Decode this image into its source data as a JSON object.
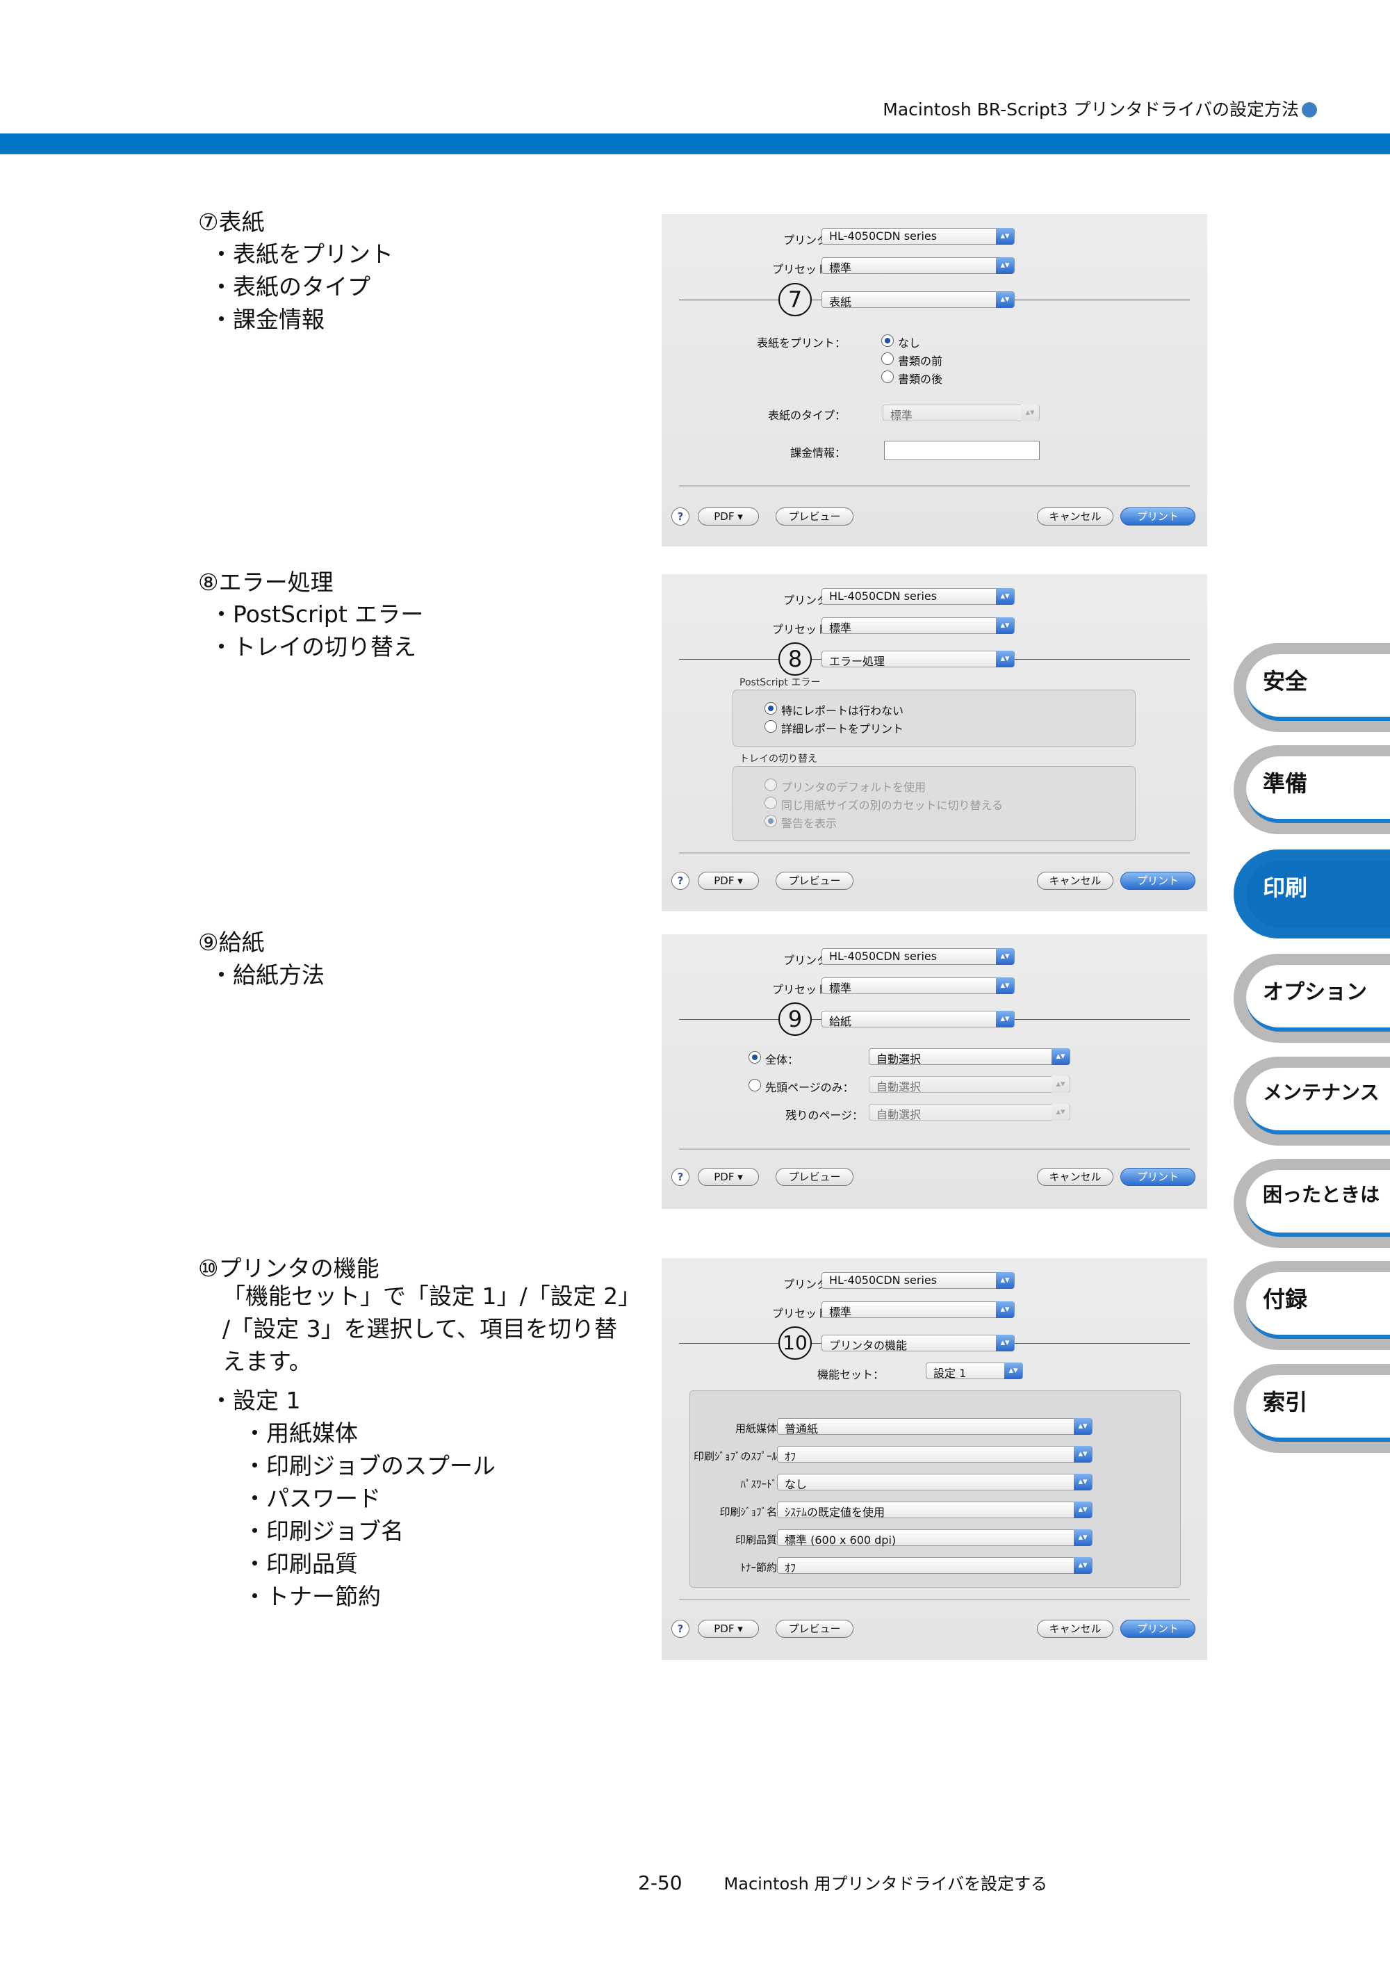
{
  "header": {
    "title": "Macintosh BR-Script3 プリンタドライバの設定方法"
  },
  "sections": [
    {
      "number": "⑦",
      "title": "表紙",
      "bullets": [
        "表紙をプリント",
        "表紙のタイプ",
        "課金情報"
      ]
    },
    {
      "number": "⑧",
      "title": "エラー処理",
      "bullets": [
        "PostScript エラー",
        "トレイの切り替え"
      ]
    },
    {
      "number": "⑨",
      "title": "給紙",
      "bullets": [
        "給紙方法"
      ]
    },
    {
      "number": "⑩",
      "title": "プリンタの機能",
      "paragraph": [
        "「機能セット」で「設定 1」/「設定 2」",
        "/「設定 3」を選択して、項目を切り替",
        "えます。"
      ],
      "bullets": [
        "設定 1"
      ],
      "sub_bullets": [
        "用紙媒体",
        "印刷ジョブのスプール",
        "パスワード",
        "印刷ジョブ名",
        "印刷品質",
        "トナー節約"
      ]
    }
  ],
  "dialog": {
    "printer_label": "プリンタ：",
    "printer_value": "HL-4050CDN series",
    "preset_label": "プリセット：",
    "preset_value": "標準",
    "help": "?",
    "pdf": "PDF ▾",
    "preview": "プレビュー",
    "cancel": "キャンセル",
    "print": "プリント",
    "arrow": "▴▾"
  },
  "dialog7": {
    "marker": "7",
    "pane": "表紙",
    "cover_print_label": "表紙をプリント：",
    "options": [
      "なし",
      "書類の前",
      "書類の後"
    ],
    "cover_type_label": "表紙のタイプ：",
    "cover_type_value": "標準",
    "billing_label": "課金情報："
  },
  "dialog8": {
    "marker": "8",
    "pane": "エラー処理",
    "ps_group": "PostScript エラー",
    "ps_options": [
      "特にレポートは行わない",
      "詳細レポートをプリント"
    ],
    "tray_group": "トレイの切り替え",
    "tray_options": [
      "プリンタのデフォルトを使用",
      "同じ用紙サイズの別のカセットに切り替える",
      "警告を表示"
    ]
  },
  "dialog9": {
    "marker": "9",
    "pane": "給紙",
    "all_label": "全体：",
    "all_value": "自動選択",
    "first_label": "先頭ページのみ：",
    "first_value": "自動選択",
    "rest_label": "残りのページ：",
    "rest_value": "自動選択"
  },
  "dialog10": {
    "marker": "10",
    "pane": "プリンタの機能",
    "feature_set_label": "機能セット：",
    "feature_set_value": "設定 1",
    "rows": [
      {
        "label": "用紙媒体:",
        "value": "普通紙"
      },
      {
        "label": "印刷ｼﾞｮﾌﾞのｽﾌﾟｰﾙ:",
        "value": "ｵﾌ"
      },
      {
        "label": "ﾊﾟｽﾜｰﾄﾞ:",
        "value": "なし"
      },
      {
        "label": "印刷ｼﾞｮﾌﾞ名:",
        "value": "ｼｽﾃﾑの既定値を使用"
      },
      {
        "label": "印刷品質:",
        "value": "標準 (600 x 600 dpi)"
      },
      {
        "label": "ﾄﾅｰ節約:",
        "value": "ｵﾌ"
      }
    ]
  },
  "tabs": [
    {
      "label": "安全",
      "active": false
    },
    {
      "label": "準備",
      "active": false
    },
    {
      "label": "印刷",
      "active": true
    },
    {
      "label": "オプション",
      "active": false
    },
    {
      "label": "メンテナンス",
      "active": false
    },
    {
      "label": "困ったときは",
      "active": false
    },
    {
      "label": "付録",
      "active": false
    },
    {
      "label": "索引",
      "active": false
    }
  ],
  "footer": {
    "page_number": "2-50",
    "chapter": "Macintosh 用プリンタドライバを設定する"
  },
  "colors": {
    "accent_blue": "#0576c6",
    "tab_active": "#0c6fc0",
    "select_arrow": "#2866c9"
  }
}
